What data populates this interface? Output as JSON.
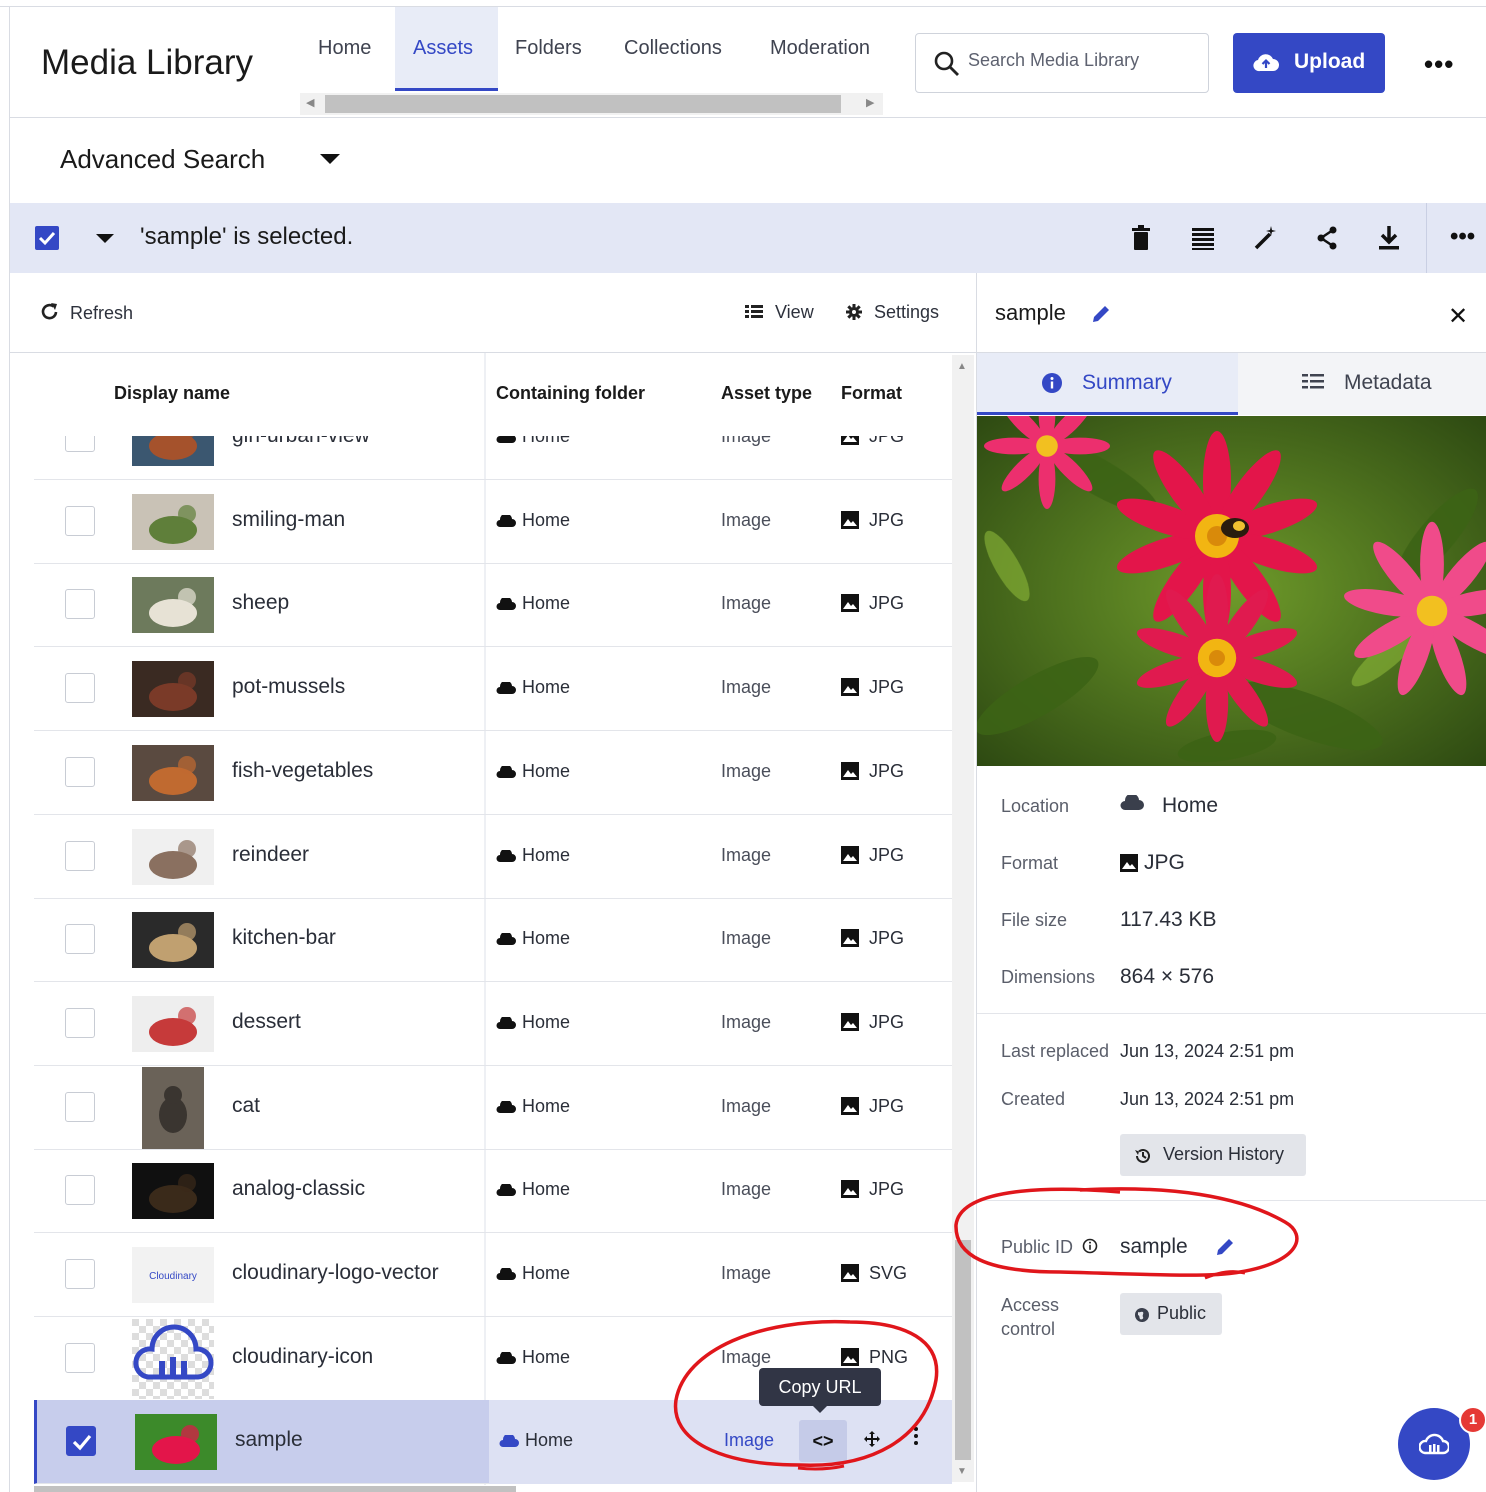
{
  "app": {
    "title": "Media Library",
    "nav_tabs": [
      "Home",
      "Assets",
      "Folders",
      "Collections",
      "Moderation"
    ],
    "active_tab": "Assets",
    "search_placeholder": "Search Media Library",
    "upload_label": "Upload",
    "accent_color": "#3448c5"
  },
  "advanced_search": {
    "label": "Advanced Search"
  },
  "selection_bar": {
    "text": "'sample' is selected.",
    "actions": [
      "trash-icon",
      "list-icon",
      "magic-wand-icon",
      "share-icon",
      "download-icon",
      "more-icon"
    ]
  },
  "list_toolbar": {
    "refresh": "Refresh",
    "view": "View",
    "settings": "Settings"
  },
  "table": {
    "columns": [
      "Display name",
      "Containing folder",
      "Asset type",
      "Format"
    ],
    "rows": [
      {
        "name": "girl-urban-view",
        "folder": "Home",
        "type": "Image",
        "format": "JPG"
      },
      {
        "name": "smiling-man",
        "folder": "Home",
        "type": "Image",
        "format": "JPG"
      },
      {
        "name": "sheep",
        "folder": "Home",
        "type": "Image",
        "format": "JPG"
      },
      {
        "name": "pot-mussels",
        "folder": "Home",
        "type": "Image",
        "format": "JPG"
      },
      {
        "name": "fish-vegetables",
        "folder": "Home",
        "type": "Image",
        "format": "JPG"
      },
      {
        "name": "reindeer",
        "folder": "Home",
        "type": "Image",
        "format": "JPG"
      },
      {
        "name": "kitchen-bar",
        "folder": "Home",
        "type": "Image",
        "format": "JPG"
      },
      {
        "name": "dessert",
        "folder": "Home",
        "type": "Image",
        "format": "JPG"
      },
      {
        "name": "cat",
        "folder": "Home",
        "type": "Image",
        "format": "JPG"
      },
      {
        "name": "analog-classic",
        "folder": "Home",
        "type": "Image",
        "format": "JPG"
      },
      {
        "name": "cloudinary-logo-vector",
        "folder": "Home",
        "type": "Image",
        "format": "SVG"
      },
      {
        "name": "cloudinary-icon",
        "folder": "Home",
        "type": "Image",
        "format": "PNG"
      },
      {
        "name": "sample",
        "folder": "Home",
        "type": "Image",
        "format": "",
        "selected": true
      }
    ],
    "tooltip": "Copy URL",
    "copy_icon": "<>",
    "thumb_logo_text": "Cloudinary"
  },
  "details": {
    "title": "sample",
    "tabs": [
      "Summary",
      "Metadata"
    ],
    "location_label": "Location",
    "location": "Home",
    "format_label": "Format",
    "format": "JPG",
    "size_label": "File size",
    "size": "117.43 KB",
    "dims_label": "Dimensions",
    "dims": "864 × 576",
    "replaced_label": "Last replaced",
    "replaced": "Jun 13, 2024 2:51 pm",
    "created_label": "Created",
    "created": "Jun 13, 2024 2:51 pm",
    "version_history": "Version History",
    "public_id_label": "Public ID",
    "public_id": "sample",
    "access_label": "Access control",
    "access": "Public"
  },
  "notification_count": "1"
}
